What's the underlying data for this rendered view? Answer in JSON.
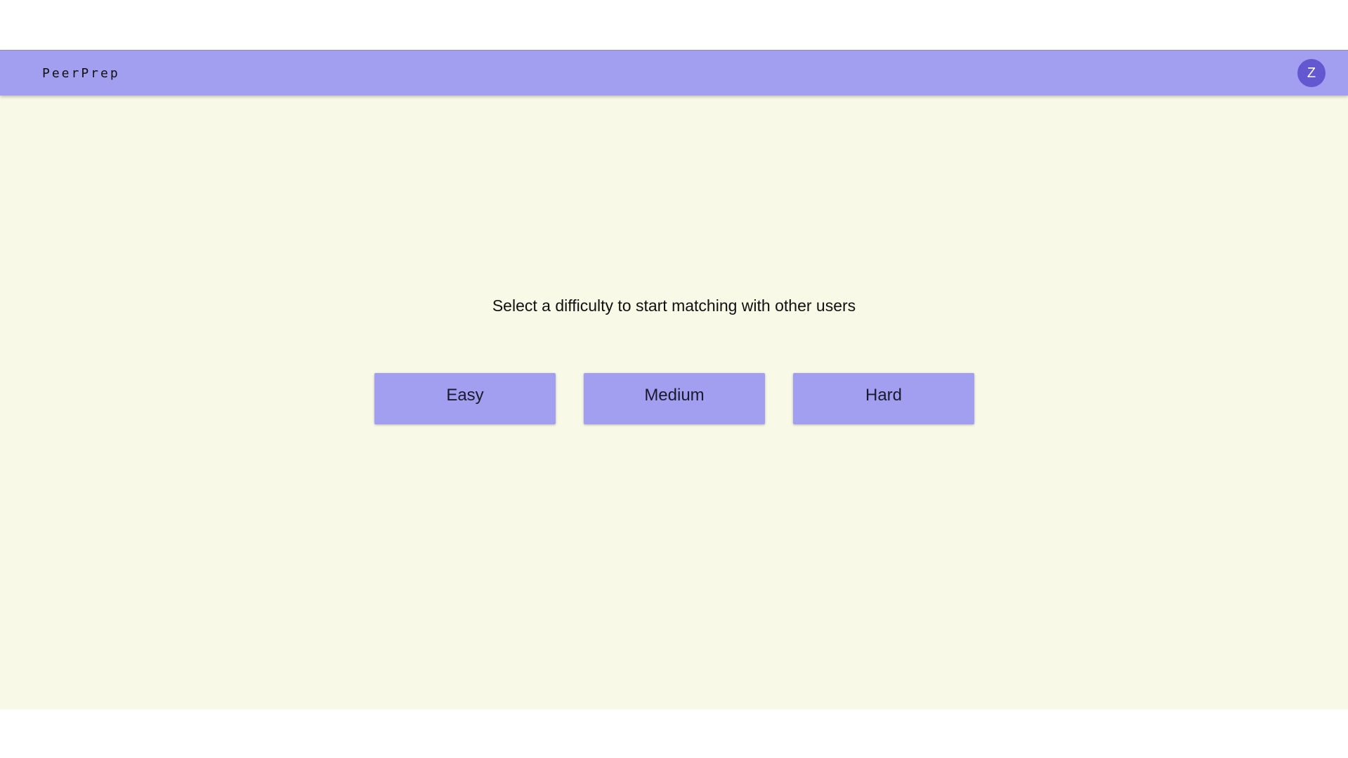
{
  "app": {
    "brand": "PeerPrep"
  },
  "header": {
    "avatar_initial": "Z"
  },
  "main": {
    "prompt": "Select a difficulty to start matching with other users",
    "difficulties": [
      {
        "label": "Easy"
      },
      {
        "label": "Medium"
      },
      {
        "label": "Hard"
      }
    ]
  },
  "colors": {
    "navbar": "#a29ef0",
    "avatar": "#6458d0",
    "background": "#f8f9e6",
    "button": "#a29ef0"
  }
}
